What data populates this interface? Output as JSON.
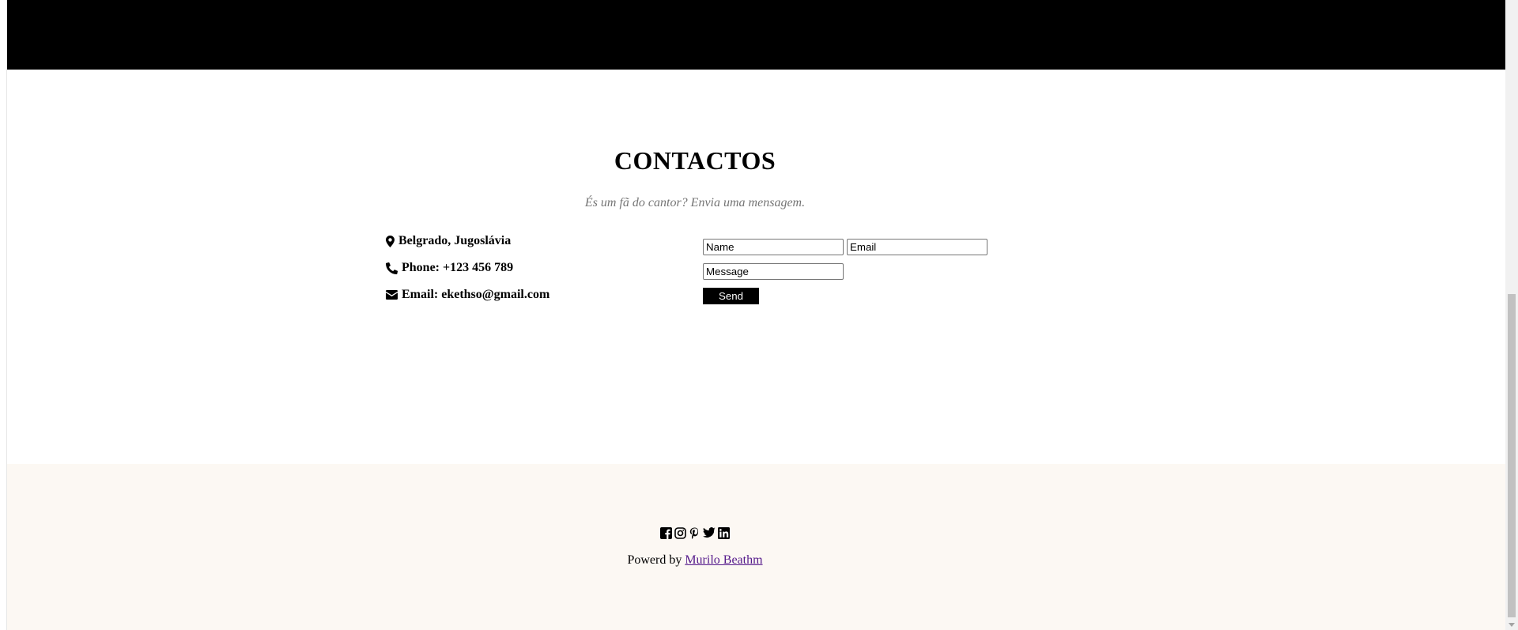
{
  "contact": {
    "title": "CONTACTOS",
    "subtitle": "És um fã do cantor? Envia uma mensagem.",
    "info": [
      {
        "icon": "map-marker-icon",
        "text": "Belgrado, Jugoslávia"
      },
      {
        "icon": "phone-icon",
        "text": "Phone: +123 456 789"
      },
      {
        "icon": "envelope-icon",
        "text": "Email: ekethso@gmail.com"
      }
    ],
    "form": {
      "name_placeholder": "Name",
      "email_placeholder": "Email",
      "message_placeholder": "Message",
      "send_label": "Send"
    }
  },
  "footer": {
    "social_icons": [
      "facebook-icon",
      "instagram-icon",
      "pinterest-icon",
      "twitter-icon",
      "linkedin-icon"
    ],
    "credit_prefix": "Powerd by",
    "credit_link": "Murilo Beathm"
  },
  "colors": {
    "header_band": "#000000",
    "footer_bg": "#fcf8f3",
    "subtitle": "#757575",
    "link_visited": "#551a8b",
    "button_bg": "#000000"
  }
}
